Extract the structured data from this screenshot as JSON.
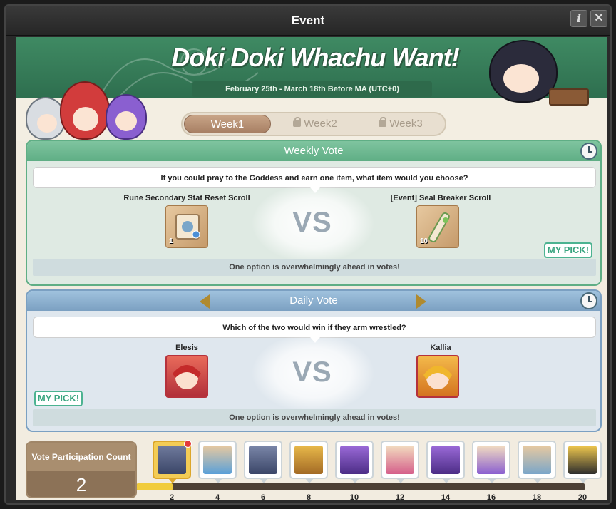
{
  "window": {
    "title": "Event"
  },
  "banner": {
    "title": "Doki Doki Whachu Want!",
    "date_range": "February 25th - March 18th Before MA (UTC+0)"
  },
  "tabs": [
    {
      "label": "Week1",
      "locked": false,
      "active": true
    },
    {
      "label": "Week2",
      "locked": true,
      "active": false
    },
    {
      "label": "Week3",
      "locked": true,
      "active": false
    }
  ],
  "weekly_vote": {
    "title": "Weekly Vote",
    "question": "If you could pray to the Goddess and earn one item, what item would you choose?",
    "option_left": {
      "name": "Rune Secondary Stat Reset Scroll",
      "qty": "1"
    },
    "option_right": {
      "name": "[Event] Seal Breaker Scroll",
      "qty": "10"
    },
    "vs": "VS",
    "my_pick": "MY PICK!",
    "my_pick_side": "right",
    "status": "One option is overwhelmingly ahead in votes!"
  },
  "daily_vote": {
    "title": "Daily Vote",
    "question": "Which of the two would win if they arm wrestled?",
    "option_left": {
      "name": "Elesis"
    },
    "option_right": {
      "name": "Kallia"
    },
    "vs": "VS",
    "my_pick": "MY PICK!",
    "my_pick_side": "left",
    "status": "One option is overwhelmingly ahead in votes!"
  },
  "participation": {
    "label": "Vote Participation Count",
    "count": "2",
    "progress_fraction": 0.08,
    "milestones": [
      "2",
      "4",
      "6",
      "8",
      "10",
      "12",
      "14",
      "16",
      "18",
      "20"
    ],
    "colors": {
      "bar_fill": "#f1cc3c",
      "bar_track": "#4d4035",
      "weekly_accent": "#5fae85",
      "daily_accent": "#7ba0c2"
    }
  }
}
